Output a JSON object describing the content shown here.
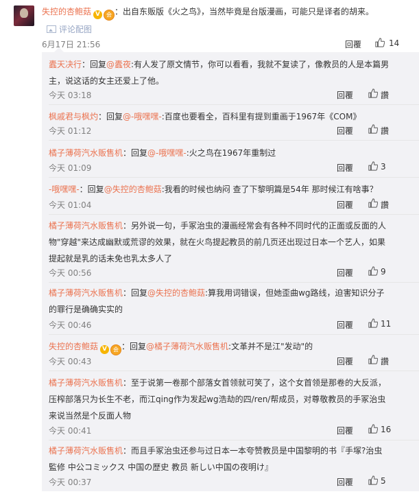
{
  "root": {
    "username": "失控的杏鲍菇",
    "text": "：出自东贩版《火之鸟》，当然毕竟是台版漫画，可能只是译者的胡来。",
    "pic_link": "评论配图",
    "time": "6月17日 21:56",
    "reply_label": "回覆",
    "likes": "14"
  },
  "replies": [
    {
      "user": "蠹天决行",
      "prefix": "：回复",
      "mention": "@蠹夜",
      "text": ":有人发了原文情节，你可以看看，我就不复读了，像教员的人是本篇男主，说这话的女主还爱上了他。",
      "time": "今天 03:18",
      "reply_label": "回覆",
      "likes": "讚"
    },
    {
      "user": "枫戚君与枫灼",
      "prefix": "：回复",
      "mention": "@-哦嘿嘿-",
      "text": ":百度也要看全，百科里有提到重画于1967年《COM》",
      "time": "今天 01:12",
      "reply_label": "回覆",
      "likes": "讚"
    },
    {
      "user": "橘子薄荷汽水贩售机",
      "prefix": "：回复",
      "mention": "@-哦嘿嘿-",
      "text": ":火之鸟在1967年重制过",
      "time": "今天 01:09",
      "reply_label": "回覆",
      "likes": "3"
    },
    {
      "user": "-哦嘿嘿-",
      "prefix": "：回复",
      "mention": "@失控的杏鲍菇",
      "text": ":我看的时候也纳闷 查了下黎明篇是54年 那时候江有啥事？",
      "time": "今天 01:04",
      "reply_label": "回覆",
      "likes": "讚"
    },
    {
      "user": "橘子薄荷汽水贩售机",
      "prefix": "",
      "mention": "",
      "text": "：另外说一句，手冢治虫的漫画经常会有各种不同时代的正面或反面的人物\"穿越\"来达成幽默或荒谬的效果，就在火鸟提起教员的前几页还出现过日本一个艺人，如果提起就是乳的话未免也乳太多人了",
      "time": "今天 00:56",
      "reply_label": "回覆",
      "likes": "9"
    },
    {
      "user": "橘子薄荷汽水贩售机",
      "prefix": "：回复",
      "mention": "@失控的杏鲍菇",
      "text": ":算我用词错误，但她歪曲wg路线，迫害知识分子的罪行是确确实实的",
      "time": "今天 00:46",
      "reply_label": "回覆",
      "likes": "11"
    },
    {
      "user": "失控的杏鲍菇",
      "prefix": "：回复",
      "mention": "@橘子薄荷汽水贩售机",
      "text": ":文革并不是江\"发动\"的",
      "time": "今天 00:43",
      "reply_label": "回覆",
      "likes": "讚"
    },
    {
      "user": "橘子薄荷汽水贩售机",
      "prefix": "",
      "mention": "",
      "text": "：至于说第一卷那个部落女首领就可笑了，这个女首领是那卷的大反派，压榨部落只为长生不老，而江qing作为发起wg浩劫的四/ren/帮成员，对尊敬教员的手冢治虫来说当然是个反面人物",
      "time": "今天 00:41",
      "reply_label": "回覆",
      "likes": "16"
    },
    {
      "user": "橘子薄荷汽水贩售机",
      "prefix": "",
      "mention": "",
      "text": "：而且手冢治虫还参与过日本一本夸赞教员是中国黎明的书『手塚?治虫 監修 中公コミックス 中国の歴史 教员 新しい中国の夜明け』",
      "time": "今天 00:37",
      "reply_label": "回覆",
      "likes": "5"
    }
  ],
  "icons": {
    "like": "thumbs-up-icon",
    "picture": "image-icon",
    "verified": "verified-v-icon",
    "vip": "vip-badge-icon"
  },
  "colors": {
    "username": "#eb7350",
    "muted": "#808080",
    "thread_bg": "#f2f2f5"
  }
}
